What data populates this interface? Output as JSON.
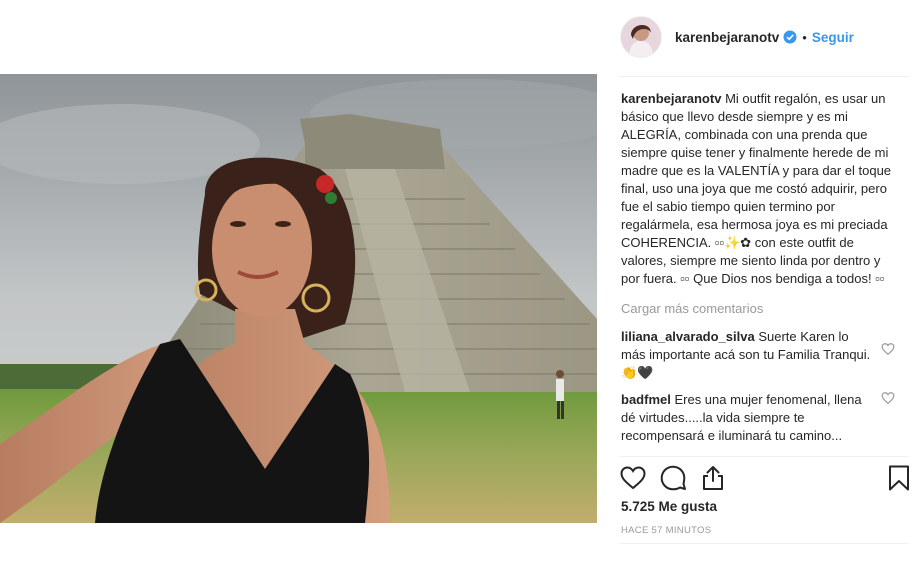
{
  "header": {
    "username": "karenbejaranotv",
    "separator": "•",
    "follow_label": "Seguir"
  },
  "caption": {
    "username": "karenbejaranotv",
    "text": "Mi outfit regalón, es usar un básico que llevo desde siempre y es mi ALEGRÍA, combinada con una prenda que siempre quise tener y finalmente herede de mi madre que es la VALENTÍA y para dar el toque final, uso una joya que me costó adquirir, pero fue el sabio tiempo quien termino por regalármela, esa hermosa joya es mi preciada COHERENCIA. ▫▫✨✿ con este outfit de valores, siempre me siento linda por dentro y por fuera. ▫▫ Que Dios nos bendiga a todos! ▫▫"
  },
  "load_more_label": "Cargar más comentarios",
  "comments": [
    {
      "username": "liliana_alvarado_silva",
      "text": "Suerte Karen lo más importante acá son tu Familia Tranqui. 👏🖤"
    },
    {
      "username": "badfmel",
      "text": "Eres una mujer fenomenal, llena dé virtudes.....la vida siempre te recompensará e iluminará tu camino..."
    }
  ],
  "likes_text": "5.725 Me gusta",
  "timestamp": "HACE 57 MINUTOS",
  "icons": {
    "like": "heart-icon",
    "comment": "comment-icon",
    "share": "share-icon",
    "save": "bookmark-icon",
    "verified": "verified-badge-icon"
  },
  "colors": {
    "link_blue": "#3897f0",
    "text": "#262626",
    "muted": "#999999",
    "divider": "#efefef"
  }
}
